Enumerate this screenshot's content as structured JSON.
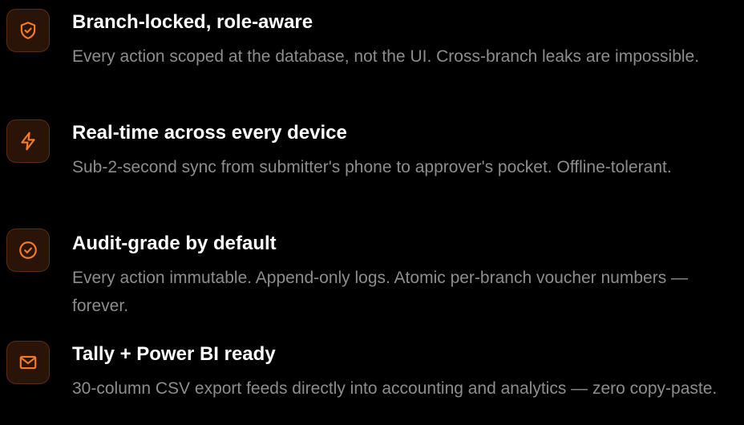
{
  "accent_color": "#f47a24",
  "features": [
    {
      "icon": "shield-check-icon",
      "title": "Branch-locked, role-aware",
      "description": "Every action scoped at the database, not the UI. Cross-branch leaks are impossible."
    },
    {
      "icon": "lightning-bolt-icon",
      "title": "Real-time across every device",
      "description": "Sub-2-second sync from submitter's phone to approver's pocket. Offline-tolerant."
    },
    {
      "icon": "check-circle-icon",
      "title": "Audit-grade by default",
      "description": "Every action immutable. Append-only logs. Atomic per-branch voucher numbers — forever."
    },
    {
      "icon": "mail-icon",
      "title": "Tally + Power BI ready",
      "description": "30-column CSV export feeds directly into accounting and analytics — zero copy-paste."
    }
  ]
}
